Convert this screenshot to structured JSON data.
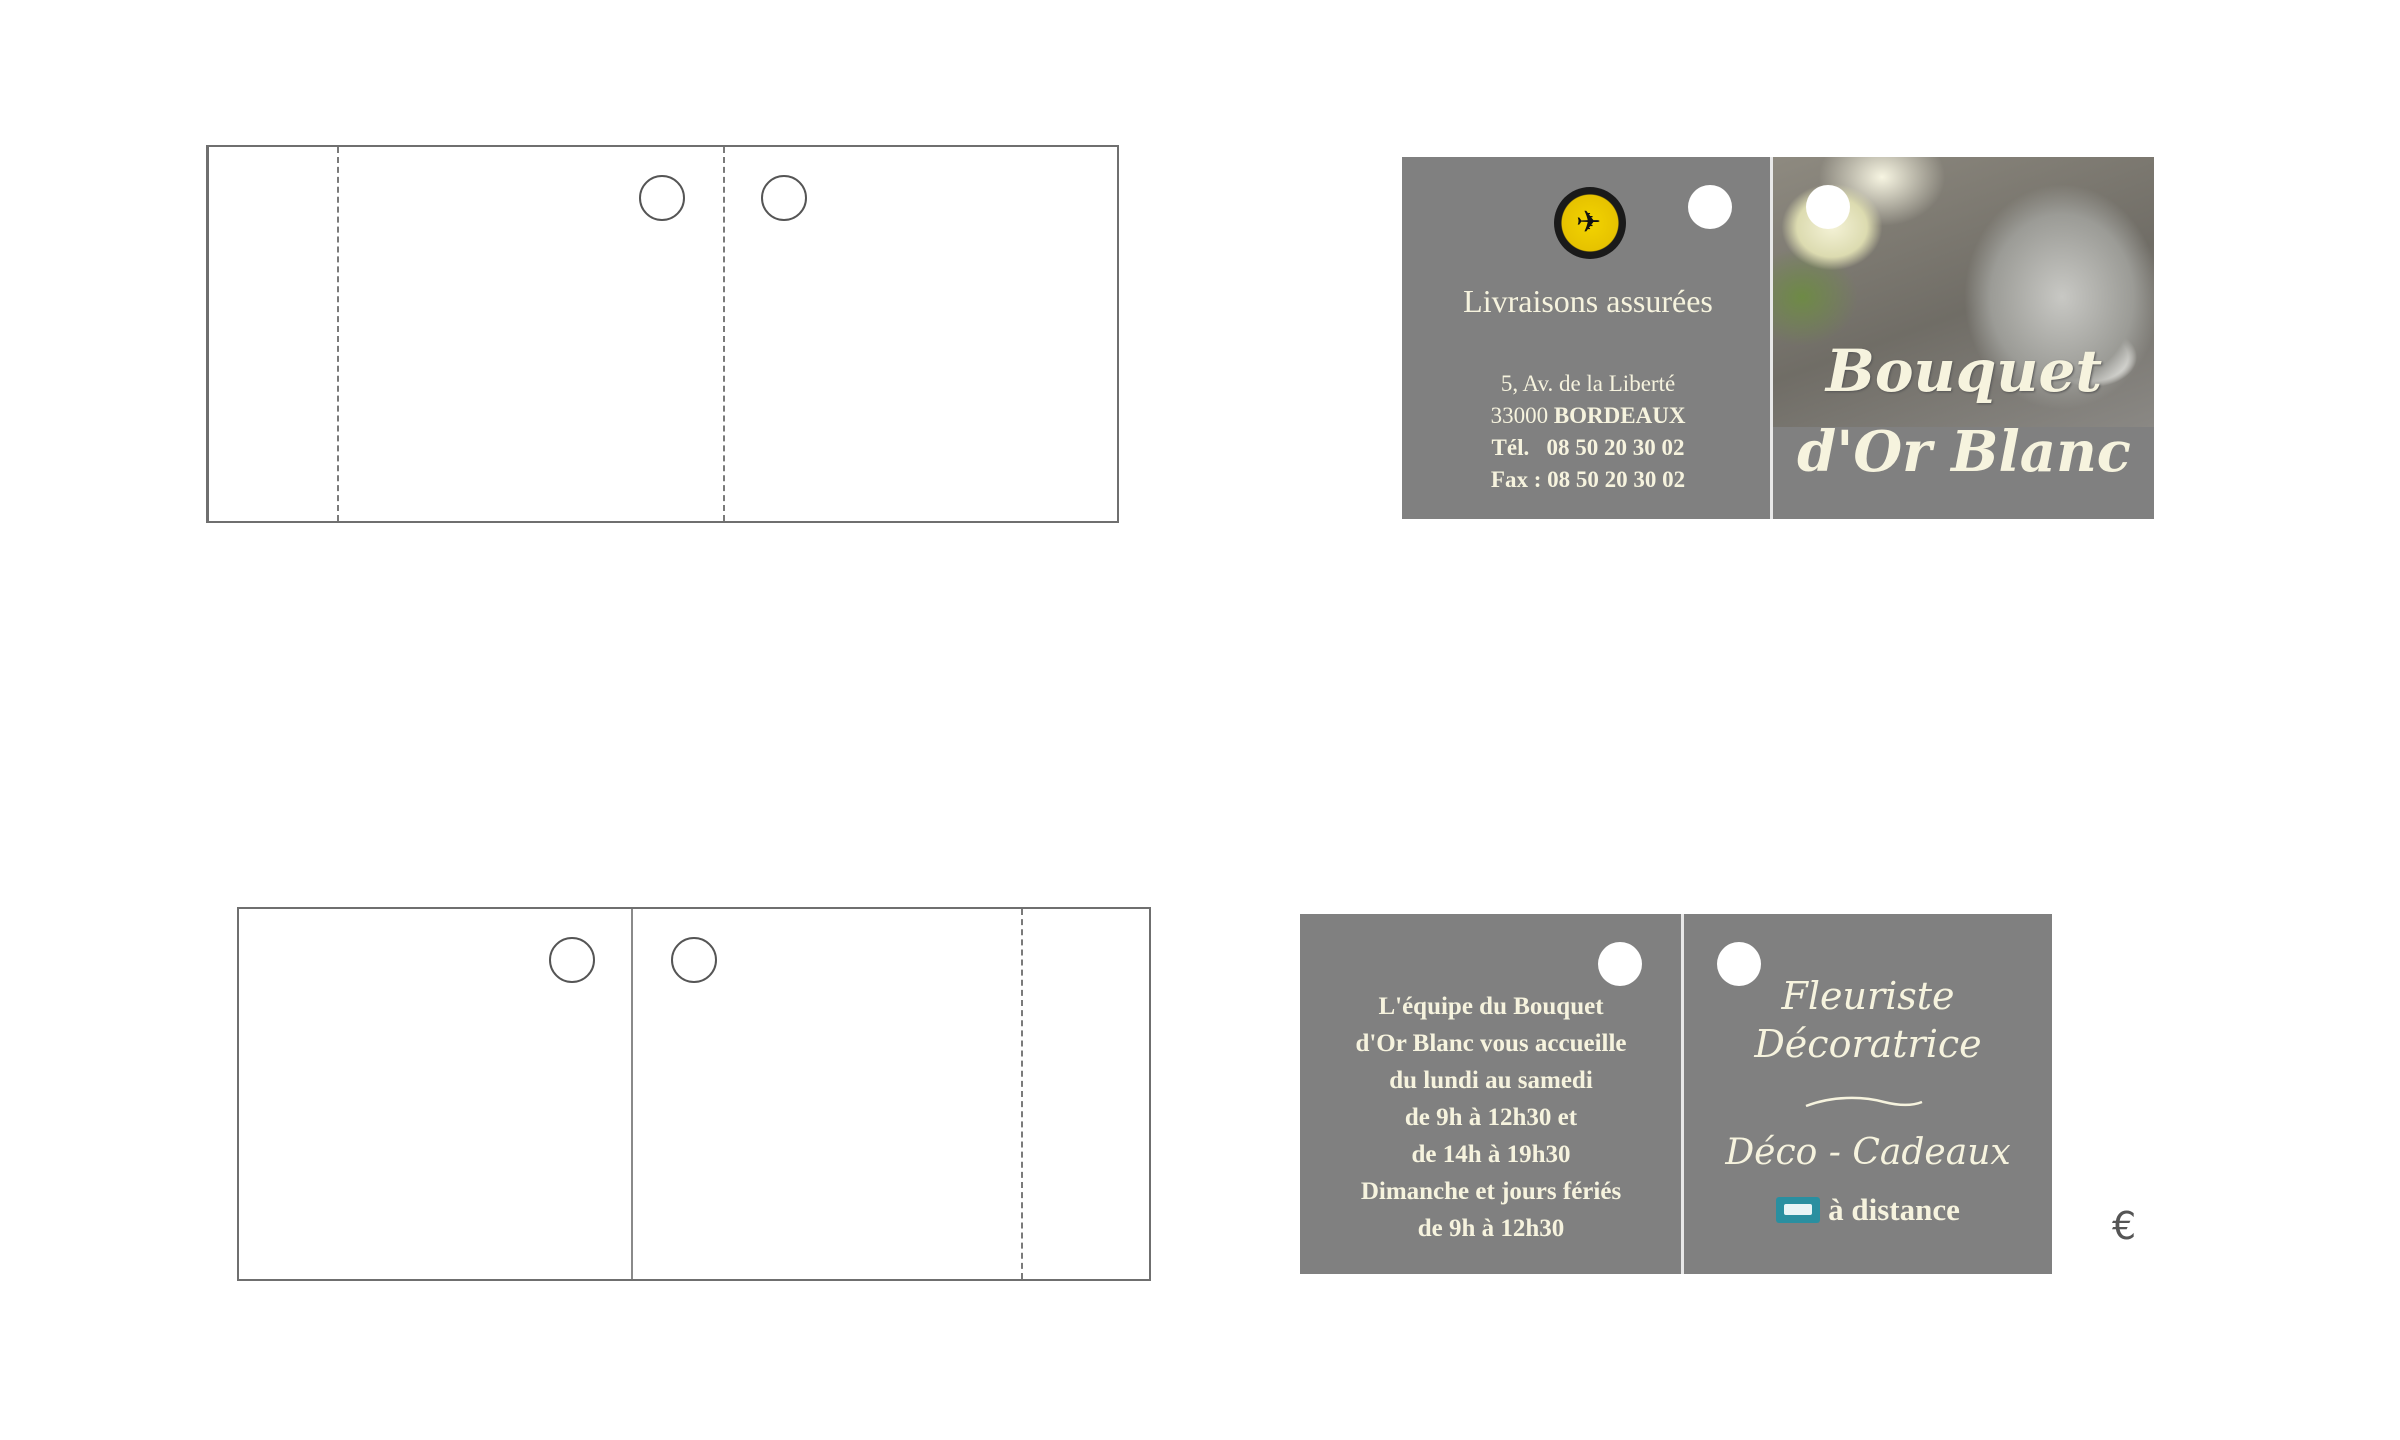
{
  "card_top": {
    "left": {
      "headline": "Livraisons assurées",
      "address_line1": "5, Av. de la Liberté",
      "postcode": "33000",
      "city": "BORDEAUX",
      "phone": "Tél.   08 50 20 30 02",
      "fax": "Fax : 08 50 20 30 02"
    },
    "right": {
      "brand_line1": "Bouquet",
      "brand_line2": "d'Or Blanc"
    }
  },
  "card_bottom": {
    "left": {
      "lines": [
        "L'équipe du Bouquet",
        "d'Or Blanc vous accueille",
        "du lundi au samedi",
        "de 9h à 12h30 et",
        "de 14h à 19h30",
        "Dimanche et jours fériés",
        "de 9h à 12h30"
      ]
    },
    "right": {
      "title_line1": "Fleuriste",
      "title_line2": "Décoratrice",
      "services": "Déco - Cadeaux",
      "remote": "à distance"
    }
  },
  "colors": {
    "card_gray": "#808080",
    "text_cream": "#f6f3de",
    "logo_yellow": "#f3d400"
  },
  "icons": {
    "payment": "credit-card-icon",
    "currency": "euro-icon"
  },
  "euro_symbol": "€"
}
